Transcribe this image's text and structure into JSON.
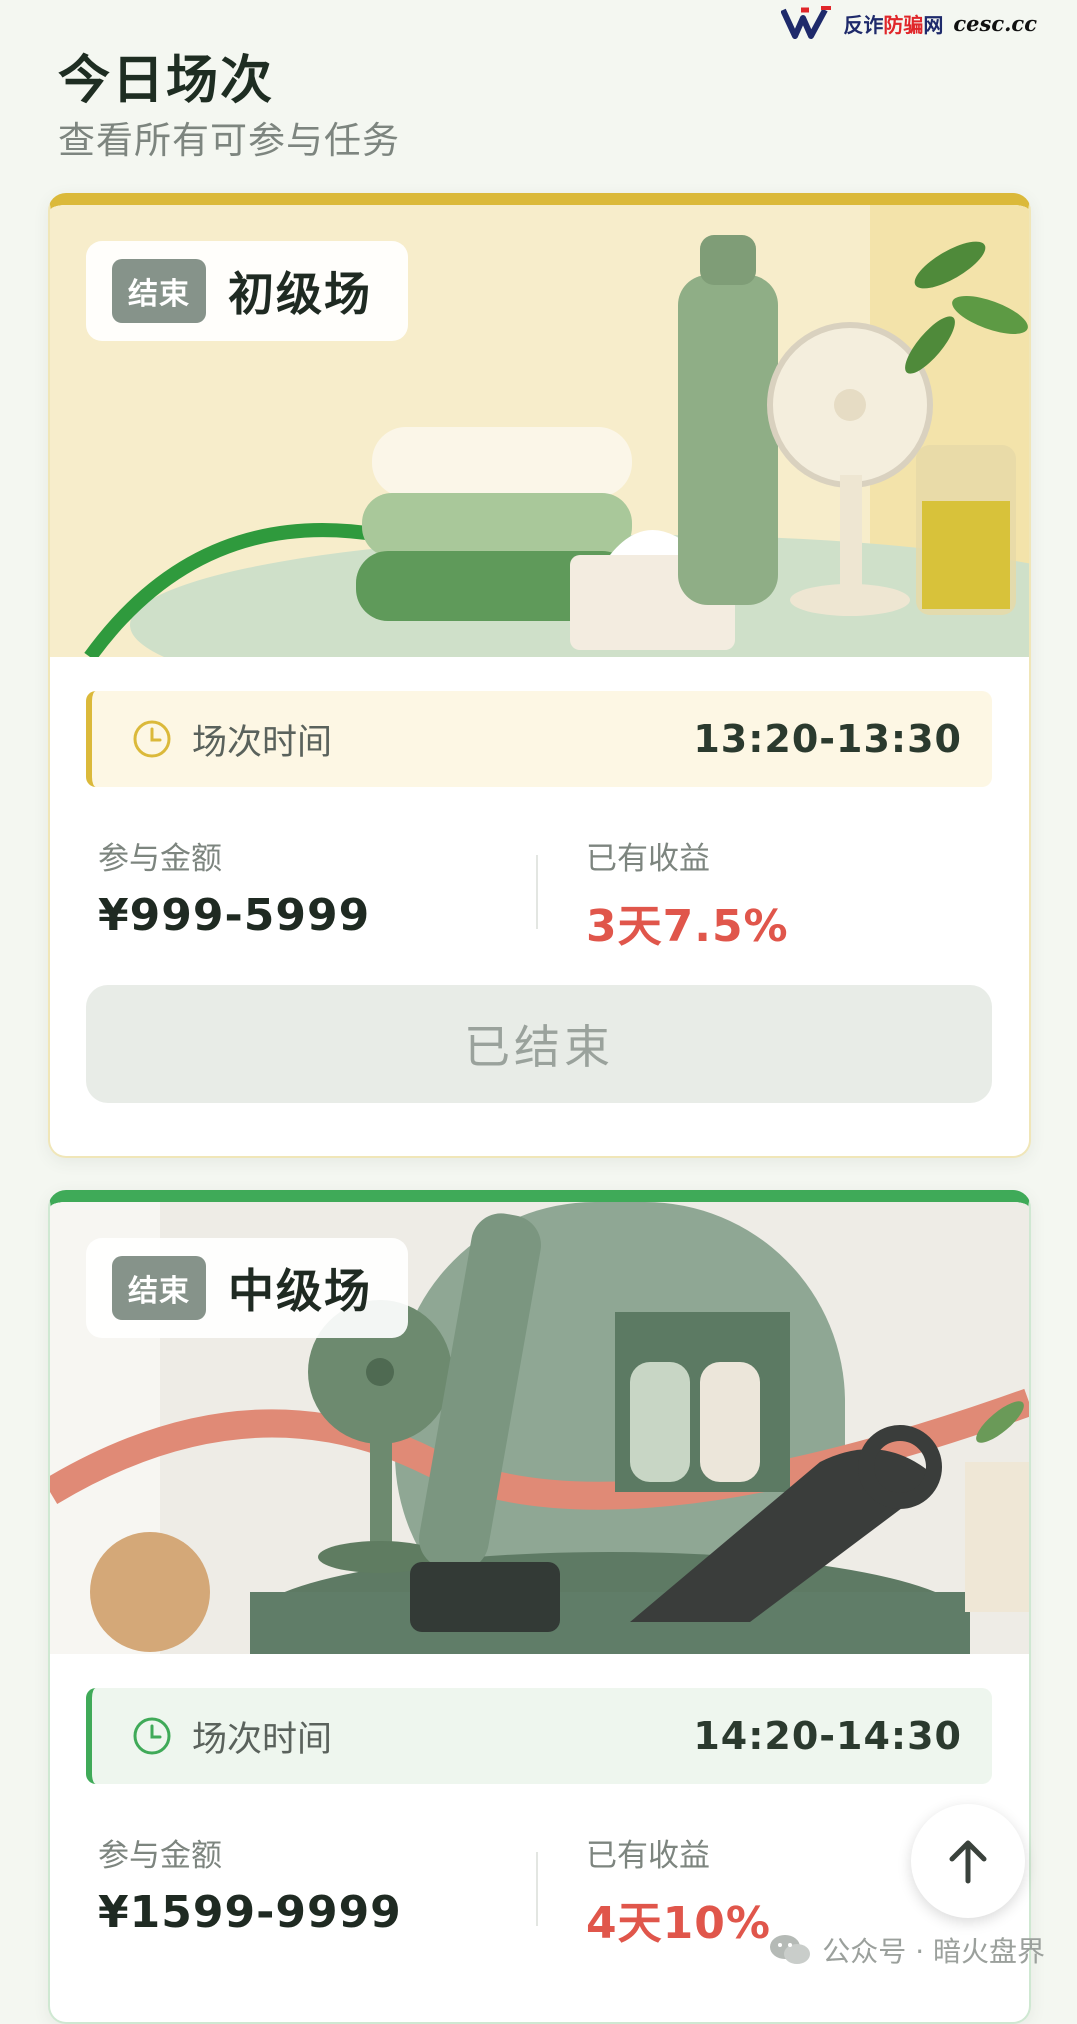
{
  "watermark_top": {
    "brand": "反诈",
    "brand_red": "防骗",
    "brand_tail": "网",
    "domain": "cesc.cc"
  },
  "header": {
    "title": "今日场次",
    "subtitle": "查看所有可参与任务"
  },
  "sessions": [
    {
      "status_tag": "结束",
      "level": "初级场",
      "time_label": "场次时间",
      "time_value": "13:20-13:30",
      "amount_label": "参与金额",
      "amount_value": "¥999-5999",
      "yield_label": "已有收益",
      "yield_value": "3天7.5%",
      "button_label": "已结束",
      "accent": "#dbb93a"
    },
    {
      "status_tag": "结束",
      "level": "中级场",
      "time_label": "场次时间",
      "time_value": "14:20-14:30",
      "amount_label": "参与金额",
      "amount_value": "¥1599-9999",
      "yield_label": "已有收益",
      "yield_value": "4天10%",
      "accent": "#3faa58"
    }
  ],
  "watermark_bottom": {
    "text": "公众号 · 暗火盘界"
  },
  "colors": {
    "yield_red": "#e0564b",
    "ended_gray": "#86938a"
  },
  "icons": [
    "clock-icon",
    "arrow-up-icon",
    "wechat-icon"
  ]
}
